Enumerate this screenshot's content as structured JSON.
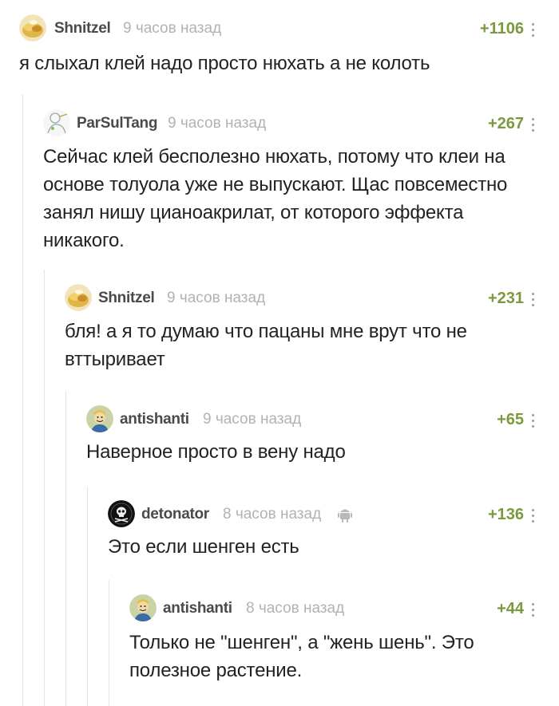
{
  "comments": [
    {
      "username": "Shnitzel",
      "time": "9 часов назад",
      "rating": "+1106",
      "text": "я слыхал клей надо просто нюхать а не колоть",
      "avatar": "shnitzel-avatar"
    },
    {
      "username": "ParSulTang",
      "time": "9 часов назад",
      "rating": "+267",
      "text": "Сейчас клей бесполезно нюхать, потому что клеи на основе толуола уже не выпускают. Щас повсеместно занял нишу цианоакрилат, от которого эффекта никакого.",
      "avatar": "parsultang-avatar"
    },
    {
      "username": "Shnitzel",
      "time": "9 часов назад",
      "rating": "+231",
      "text": "бля! а я то думаю что пацаны мне врут что не вттыривает",
      "avatar": "shnitzel-avatar"
    },
    {
      "username": "antishanti",
      "time": "9 часов назад",
      "rating": "+65",
      "text": "Наверное просто в вену надо",
      "avatar": "vault-boy-avatar"
    },
    {
      "username": "detonator",
      "time": "8 часов назад",
      "rating": "+136",
      "text": "Это если шенген есть",
      "avatar": "skull-avatar",
      "platform_icon": "android-icon"
    },
    {
      "username": "antishanti",
      "time": "8 часов назад",
      "rating": "+44",
      "text": "Только не \"шенген\", а \"жень шень\". Это полезное растение.",
      "avatar": "vault-boy-avatar"
    }
  ],
  "colors": {
    "rating": "#7a9a3c",
    "username": "#4a4a4a",
    "time": "#b2b2b2",
    "thread_line": "#e4e4e4"
  }
}
